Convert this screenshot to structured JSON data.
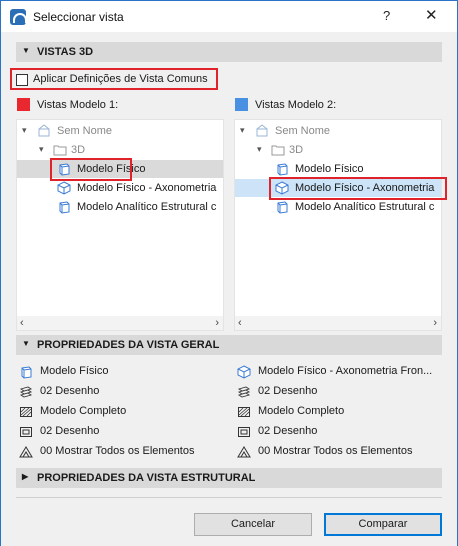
{
  "window": {
    "title": "Seleccionar vista",
    "help": "?",
    "close": "✕"
  },
  "sections": {
    "views3d": "VISTAS 3D",
    "general": "PROPRIEDADES DA VISTA GERAL",
    "structural": "PROPRIEDADES DA VISTA ESTRUTURAL"
  },
  "common_checkbox": {
    "label": "Aplicar Definições de Vista Comuns",
    "checked": false
  },
  "left_panel": {
    "label": "Vistas Modelo 1:",
    "color": "#e8282e",
    "tree": {
      "root": "Sem Nome",
      "folder": "3D",
      "items": [
        "Modelo Físico",
        "Modelo Físico - Axonometria",
        "Modelo Analítico Estrutural c"
      ],
      "selected_index": 0
    }
  },
  "right_panel": {
    "label": "Vistas Modelo 2:",
    "color": "#4a90e2",
    "tree": {
      "root": "Sem Nome",
      "folder": "3D",
      "items": [
        "Modelo Físico",
        "Modelo Físico - Axonometria",
        "Modelo Analítico Estrutural c"
      ],
      "selected_index": 1
    }
  },
  "general_props": {
    "left": [
      "Modelo Físico",
      "02 Desenho",
      "Modelo Completo",
      "02 Desenho",
      "00 Mostrar Todos os Elementos"
    ],
    "right": [
      "Modelo Físico - Axonometria Fron...",
      "02 Desenho",
      "Modelo Completo",
      "02 Desenho",
      "00 Mostrar Todos os Elementos"
    ]
  },
  "buttons": {
    "cancel": "Cancelar",
    "compare": "Comparar"
  },
  "scroll": {
    "left": "‹",
    "right": "›"
  }
}
